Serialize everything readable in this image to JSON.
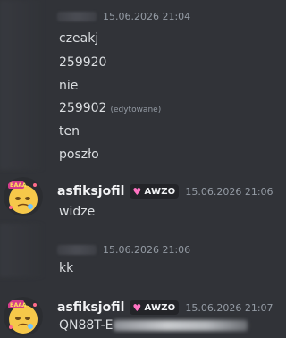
{
  "messages": [
    {
      "author_display": "",
      "timestamp": "15.06.2026 21:04",
      "lines": [
        "czeakj",
        "259920",
        "nie",
        "259902",
        "ten",
        "poszło"
      ],
      "edited_label": "(edytowane)"
    },
    {
      "author": "asfiksjofil",
      "badge": "AWZO",
      "timestamp": "15.06.2026 21:06",
      "lines": [
        "widze"
      ]
    },
    {
      "author_display": "",
      "timestamp": "15.06.2026 21:06",
      "lines": [
        "kk"
      ]
    },
    {
      "author": "asfiksjofil",
      "badge": "AWZO",
      "timestamp": "15.06.2026 21:07",
      "lines": [
        "QN88T-E"
      ]
    }
  ],
  "colors": {
    "background": "#313338",
    "text": "#dbdee1",
    "muted": "#949ba4",
    "badge_heart": "#ff73c2"
  },
  "icons": [
    "avatar-emoji",
    "heart-badge-icon"
  ]
}
